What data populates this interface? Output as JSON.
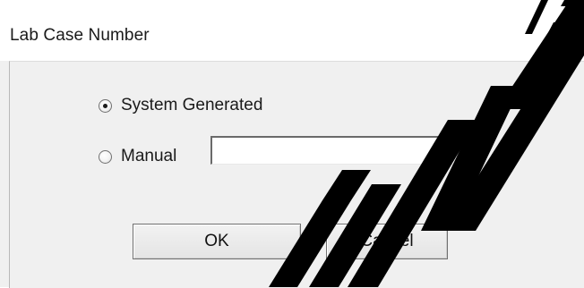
{
  "window": {
    "title": "Lab Case Number"
  },
  "options": [
    {
      "label": "System Generated",
      "selected": true
    },
    {
      "label": "Manual",
      "selected": false
    }
  ],
  "manual_field": {
    "value": "",
    "placeholder": ""
  },
  "buttons": {
    "ok_label": "OK",
    "cancel_label": "Cancel"
  },
  "watermark": {
    "text": "ARCHIVE",
    "color": "#000000"
  }
}
